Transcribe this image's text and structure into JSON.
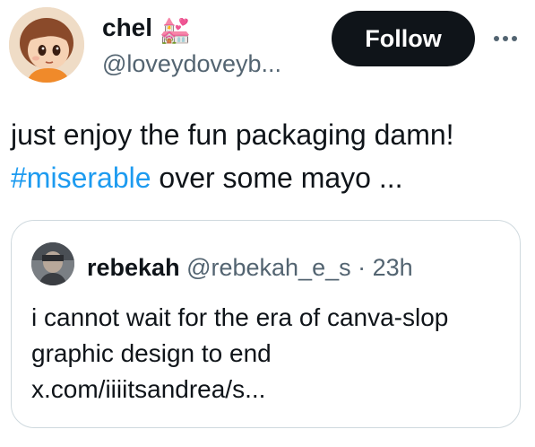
{
  "author": {
    "name": "chel",
    "name_emoji": "💒",
    "handle": "@loveydoveyb..."
  },
  "actions": {
    "follow_label": "Follow",
    "more_icon": "more-horizontal-icon"
  },
  "tweet": {
    "text_before": "just enjoy the fun packaging damn! ",
    "hashtag": "#miserable",
    "text_after": " over some mayo ..."
  },
  "quote": {
    "name": "rebekah",
    "handle": "@rebekah_e_s",
    "separator": "·",
    "time": "23h",
    "text": "i cannot wait for the era of canva-slop graphic design to end x.com/iiiitsandrea/s..."
  },
  "colors": {
    "accent": "#1d9bf0",
    "text": "#0f1419",
    "muted": "#536471",
    "border": "#cfd9de",
    "follow_bg": "#0f1419"
  }
}
